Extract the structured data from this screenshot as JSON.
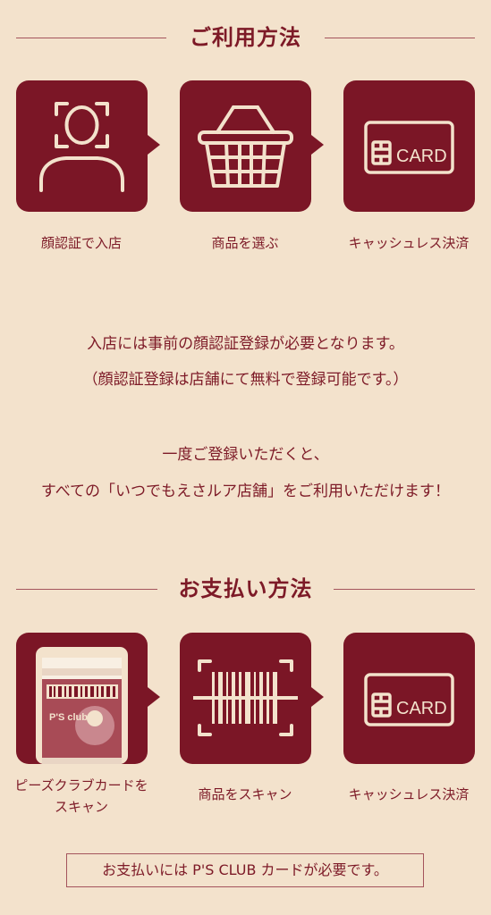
{
  "usage": {
    "heading": "ご利用方法",
    "steps": [
      {
        "label": "顔認証で入店",
        "icon": "face-scan-icon"
      },
      {
        "label": "商品を選ぶ",
        "icon": "basket-icon"
      },
      {
        "label": "キャッシュレス決済",
        "icon": "card-icon"
      }
    ],
    "card_text": "CARD",
    "note_line1": "入店には事前の顔認証登録が必要となります。",
    "note_line2": "（顔認証登録は店舗にて無料で登録可能です。）",
    "note_line3": "一度ご登録いただくと、",
    "note_line4": "すべての「いつでもえさルア店舗」をご利用いただけます！"
  },
  "payment": {
    "heading": "お支払い方法",
    "steps": [
      {
        "label_line1": "ピーズクラブカードを",
        "label_line2": "スキャン",
        "icon": "ps-club-app-icon"
      },
      {
        "label": "商品をスキャン",
        "icon": "barcode-scan-icon"
      },
      {
        "label": "キャッシュレス決済",
        "icon": "card-icon"
      }
    ],
    "card_text": "CARD",
    "app_brand": "P'S club",
    "notice": "お支払いには P'S CLUB カードが必要です。"
  },
  "colors": {
    "accent": "#7B1626",
    "background": "#F3E2CC",
    "line": "#A4545C",
    "icon_cream": "#F3E2CC"
  }
}
